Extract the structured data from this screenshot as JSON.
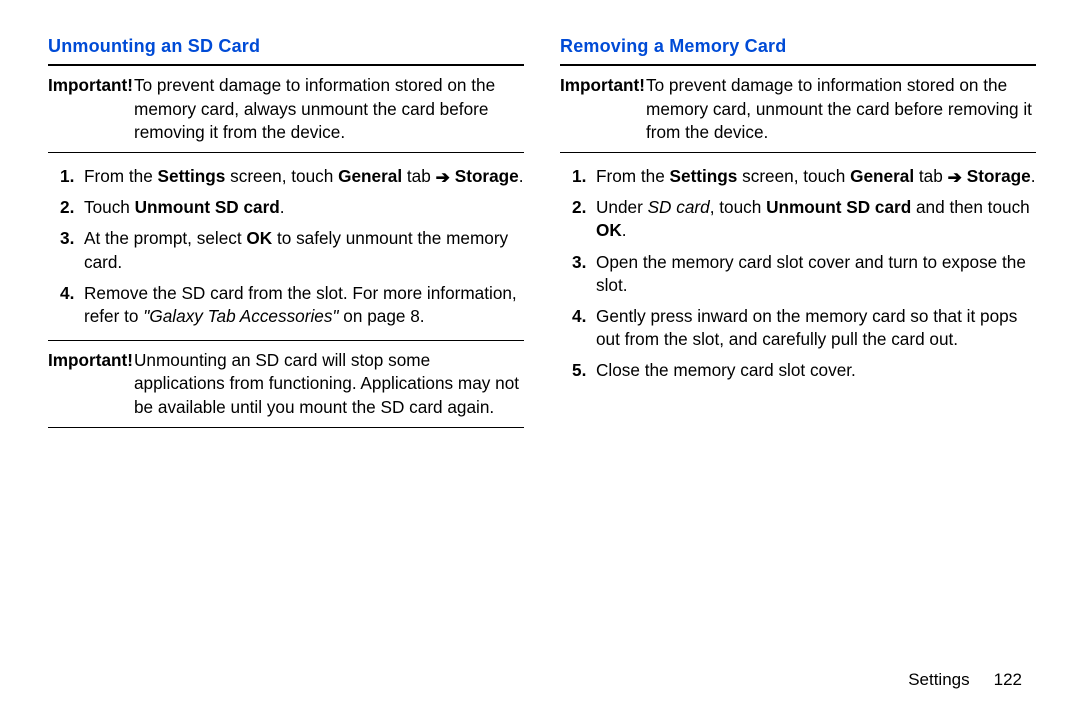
{
  "left": {
    "title": "Unmounting an SD Card",
    "imp1_label": "Important!",
    "imp1_text": "To prevent damage to information stored on the memory card, always unmount the card before removing it from the device.",
    "step1_a": "From the ",
    "step1_settings": "Settings",
    "step1_b": " screen, touch ",
    "step1_general": "General",
    "step1_c": " tab ",
    "step1_arrow": "➔",
    "step1_storage": "Storage",
    "step1_d": ".",
    "step2_a": "Touch ",
    "step2_unmount": "Unmount SD card",
    "step2_b": ".",
    "step3_a": "At the prompt, select ",
    "step3_ok": "OK",
    "step3_b": " to safely unmount the memory card.",
    "step4_a": "Remove the SD card from the slot. For more information, refer to ",
    "step4_ref": "\"Galaxy Tab Accessories\"",
    "step4_b": " on page 8.",
    "imp2_label": "Important!",
    "imp2_text": "Unmounting an SD card will stop some applications from functioning. Applications may not be available until you mount the SD card again."
  },
  "right": {
    "title": "Removing a Memory Card",
    "imp1_label": "Important!",
    "imp1_text": "To prevent damage to information stored on the memory card, unmount the card before removing it from the device.",
    "step1_a": "From the ",
    "step1_settings": "Settings",
    "step1_b": " screen, touch ",
    "step1_general": "General",
    "step1_c": " tab ",
    "step1_arrow": "➔",
    "step1_storage": "Storage",
    "step1_d": ".",
    "step2_a": "Under ",
    "step2_sd": "SD card",
    "step2_b": ", touch ",
    "step2_unmount": "Unmount SD card",
    "step2_c": " and then touch ",
    "step2_ok": "OK",
    "step2_d": ".",
    "step3": "Open the memory card slot cover and turn to expose the slot.",
    "step4": "Gently press inward on the memory card so that it pops out from the slot, and carefully pull the card out.",
    "step5": "Close the memory card slot cover."
  },
  "footer": {
    "section": "Settings",
    "page": "122"
  }
}
